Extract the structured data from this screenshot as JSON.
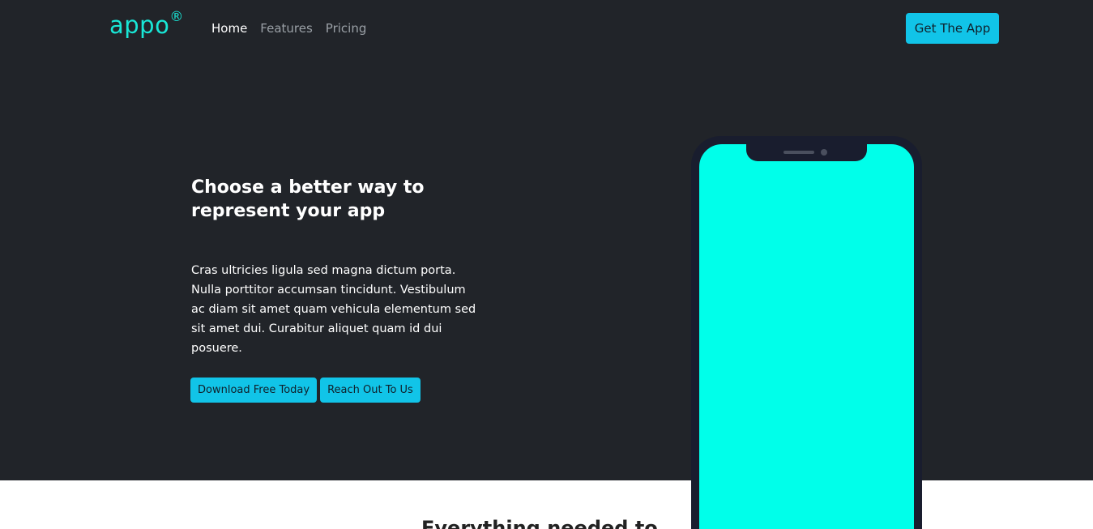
{
  "nav": {
    "logo": "appo",
    "logo_mark": "®",
    "links": [
      {
        "label": "Home",
        "active": true
      },
      {
        "label": "Features",
        "active": false
      },
      {
        "label": "Pricing",
        "active": false
      }
    ],
    "cta_label": "Get The App"
  },
  "hero": {
    "title": "Choose a better way to represent your app",
    "text": "Cras ultricies ligula sed magna dictum porta. Nulla porttitor accumsan tincidunt. Vestibulum ac diam sit amet quam vehicula elementum sed sit amet dui. Curabitur aliquet quam id dui posuere.",
    "primary_button": "Download Free Today",
    "secondary_button": "Reach Out To Us"
  },
  "next_section": {
    "title": "Everything needed to"
  },
  "colors": {
    "hero_bg": "#212429",
    "accent": "#11c4e8",
    "logo": "#19e6d6",
    "phone_screen": "#00ffea",
    "phone_frame": "#191d2e"
  }
}
